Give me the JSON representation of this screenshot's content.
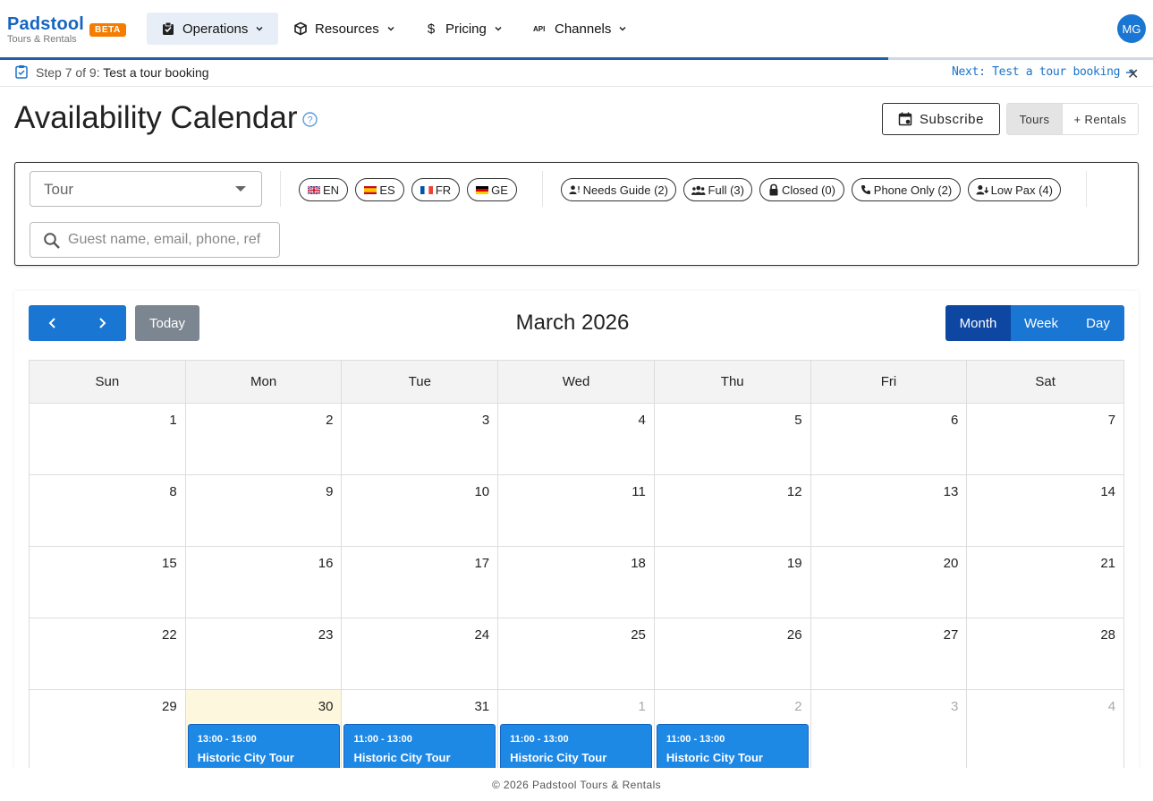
{
  "brand": {
    "name": "Padstool",
    "subtitle": "Tours & Rentals",
    "badge": "BETA"
  },
  "nav": {
    "items": [
      {
        "label": "Operations",
        "icon": "clipboard-check-icon",
        "active": true
      },
      {
        "label": "Resources",
        "icon": "box-icon"
      },
      {
        "label": "Pricing",
        "icon": "dollar-icon"
      },
      {
        "label": "Channels",
        "icon": "api-icon"
      }
    ],
    "avatar": "MG"
  },
  "onboarding": {
    "progress_fraction": 0.77,
    "step_prefix": "Step 7 of 9:",
    "step_title": "Test a tour booking",
    "next_label": "Next: Test a tour booking"
  },
  "page": {
    "title": "Availability Calendar",
    "subscribe_label": "Subscribe",
    "mode_toggle": [
      "Tours",
      "+ Rentals"
    ]
  },
  "filters": {
    "tour_placeholder": "Tour",
    "languages": [
      "EN",
      "ES",
      "FR",
      "GE"
    ],
    "statuses": [
      {
        "label": "Needs Guide (2)",
        "icon": "person-alert-icon"
      },
      {
        "label": "Full (3)",
        "icon": "group-icon"
      },
      {
        "label": "Closed (0)",
        "icon": "lock-icon"
      },
      {
        "label": "Phone Only (2)",
        "icon": "phone-icon"
      },
      {
        "label": "Low Pax (4)",
        "icon": "person-down-icon"
      }
    ],
    "guest_search_placeholder": "Guest name, email, phone, ref"
  },
  "calendar": {
    "today_label": "Today",
    "month_title": "March 2026",
    "views": [
      "Month",
      "Week",
      "Day"
    ],
    "active_view": "Month",
    "weekdays": [
      "Sun",
      "Mon",
      "Tue",
      "Wed",
      "Thu",
      "Fri",
      "Sat"
    ],
    "weeks": [
      [
        "1",
        "2",
        "3",
        "4",
        "5",
        "6",
        "7"
      ],
      [
        "8",
        "9",
        "10",
        "11",
        "12",
        "13",
        "14"
      ],
      [
        "15",
        "16",
        "17",
        "18",
        "19",
        "20",
        "21"
      ],
      [
        "22",
        "23",
        "24",
        "25",
        "26",
        "27",
        "28"
      ],
      [
        "29",
        "30",
        "31",
        "1",
        "2",
        "3",
        "4"
      ]
    ],
    "events": {
      "mon": {
        "time": "13:00 - 15:00",
        "name": "Historic City Tour"
      },
      "tue": {
        "time": "11:00 - 13:00",
        "name": "Historic City Tour"
      },
      "wed": {
        "time": "11:00 - 13:00",
        "name": "Historic City Tour"
      },
      "thu": {
        "time": "11:00 - 13:00",
        "name": "Historic City Tour"
      }
    }
  },
  "footer": "© 2026 Padstool Tours & Rentals",
  "colors": {
    "primary": "#1976d2",
    "active_view": "#0d47a1",
    "beta": "#f57c00",
    "today_bg": "#fdf7dd"
  }
}
